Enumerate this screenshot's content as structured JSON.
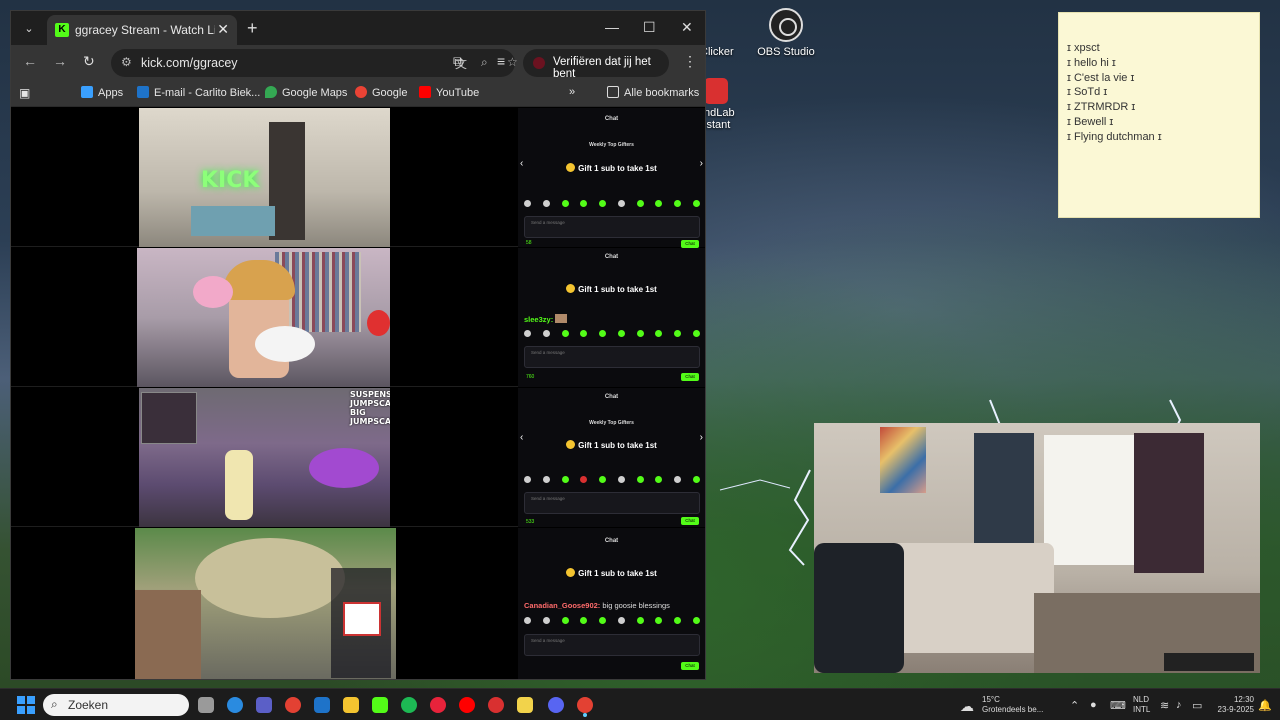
{
  "browser": {
    "tab_title": "ggracey Stream - Watch Live on Kick",
    "tab_favicon": "K",
    "url": "kick.com/ggracey",
    "verify_label": "Verifiëren dat jij het bent",
    "bookmarks": [
      {
        "label": "Apps",
        "icon": "apps-grid-icon",
        "color": "#3aa0ff"
      },
      {
        "label": "E-mail - Carlito Biek...",
        "icon": "outlook-icon",
        "color": "#1e73c9"
      },
      {
        "label": "Google Maps",
        "icon": "maps-pin-icon",
        "color": "#34a853"
      },
      {
        "label": "Google",
        "icon": "google-icon",
        "color": "#ea4335"
      },
      {
        "label": "YouTube",
        "icon": "youtube-icon",
        "color": "#ff0000"
      }
    ],
    "all_bookmarks": "Alle bookmarks"
  },
  "chats": [
    {
      "header": "Chat",
      "sub": "Weekly Top Gifters",
      "gift": "Gift 1 sub to take 1st",
      "input_placeholder": "Send a message",
      "points": "58",
      "send": "Chat"
    },
    {
      "header": "Chat",
      "gift": "Gift 1 sub to take 1st",
      "message_user": "slee3zy:",
      "input_placeholder": "Send a message",
      "points": "760",
      "send": "Chat"
    },
    {
      "header": "Chat",
      "sub": "Weekly Top Gifters",
      "gift": "Gift 1 sub to take 1st",
      "input_placeholder": "Send a message",
      "points": "533",
      "send": "Chat"
    },
    {
      "header": "Chat",
      "gift": "Gift 1 sub to take 1st",
      "message_user": "Canadian_Goose902:",
      "message_text": "big goosie blessings",
      "input_placeholder": "Send a message",
      "send": "Chat"
    }
  ],
  "stream_overlays": {
    "suspense_1": "SUSPENSE",
    "suspense_2": "JUMPSCARE",
    "suspense_3": "BIG",
    "suspense_4": "JUMPSCARE",
    "neon_sign": "KICK"
  },
  "desktop": {
    "icons": [
      {
        "label": "OBS Studio"
      },
      {
        "label": "Clicker"
      },
      {
        "label": "ndLab\nistant"
      }
    ],
    "sticky_lines": [
      "ɪ xpsct",
      "ɪ hello hi ɪ",
      "ɪ C'est la vie ɪ",
      "ɪ SoTd ɪ",
      "ɪ ZTRMRDR ɪ",
      "ɪ Bewell ɪ",
      " ɪ Flying dutchman ɪ"
    ]
  },
  "taskbar": {
    "search_placeholder": "Zoeken",
    "weather_temp": "15°C",
    "weather_desc": "Grotendeels be...",
    "lang_1": "NLD",
    "lang_2": "INTL",
    "time": "12:30",
    "date": "23-9-2025"
  }
}
